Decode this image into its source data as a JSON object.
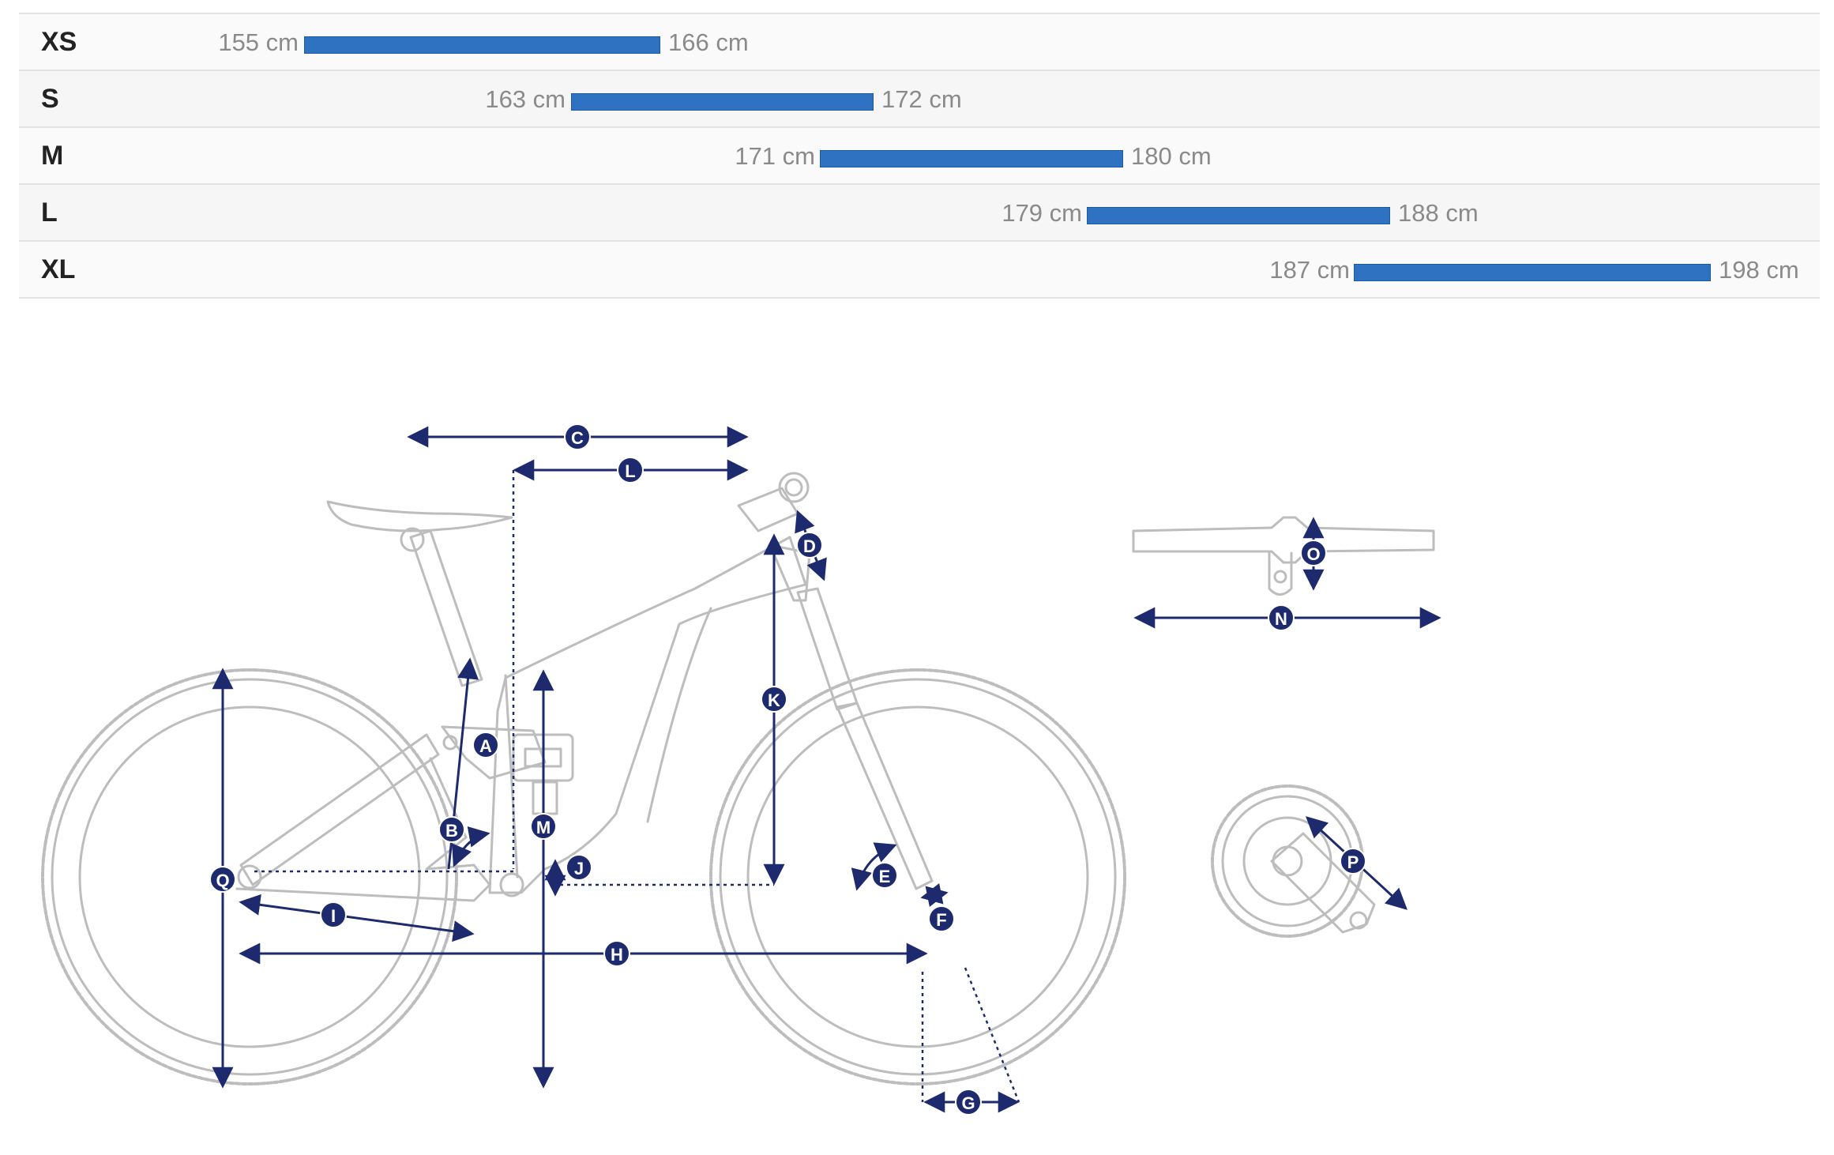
{
  "size_chart": {
    "unit": "cm",
    "rows": [
      {
        "size": "XS",
        "min": "155 cm",
        "max": "166 cm",
        "range": [
          155,
          166
        ]
      },
      {
        "size": "S",
        "min": "163 cm",
        "max": "172 cm",
        "range": [
          163,
          172
        ]
      },
      {
        "size": "M",
        "min": "171 cm",
        "max": "180 cm",
        "range": [
          171,
          180
        ]
      },
      {
        "size": "L",
        "min": "179 cm",
        "max": "188 cm",
        "range": [
          179,
          188
        ]
      },
      {
        "size": "XL",
        "min": "187 cm",
        "max": "198 cm",
        "range": [
          187,
          198
        ]
      }
    ]
  },
  "geometry_labels": {
    "A": "A",
    "B": "B",
    "C": "C",
    "D": "D",
    "E": "E",
    "F": "F",
    "G": "G",
    "H": "H",
    "I": "I",
    "J": "J",
    "K": "K",
    "L": "L",
    "M": "M",
    "N": "N",
    "O": "O",
    "P": "P",
    "Q": "Q"
  },
  "colors": {
    "bar": "#2f72c2",
    "marker": "#1e2a6e",
    "bike_outline": "#bdbdbd",
    "text_muted": "#8a8a8a",
    "text_strong": "#222222"
  }
}
